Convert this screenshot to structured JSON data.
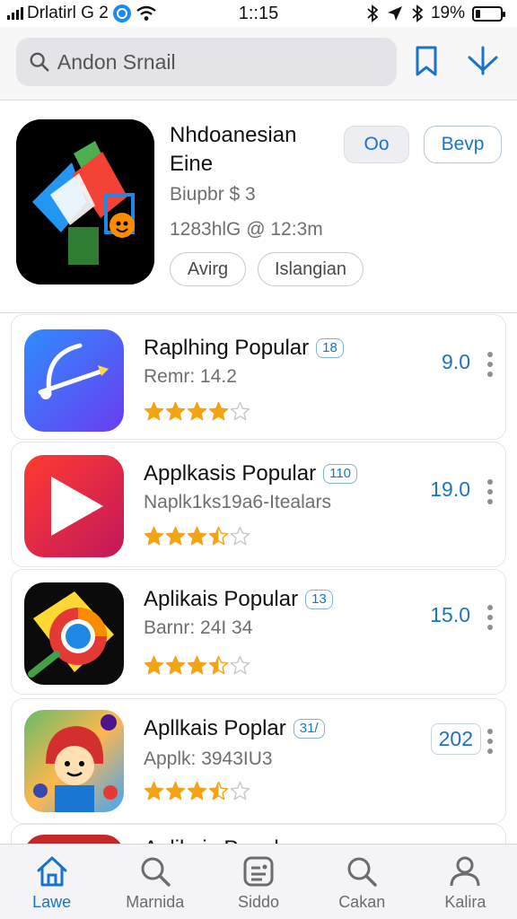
{
  "status_bar": {
    "carrier": "Drlatirl G 2",
    "time": "1::15",
    "battery": "19%",
    "battery_level": 0.19
  },
  "search": {
    "placeholder": "Andon Srnail"
  },
  "featured": {
    "title": "Nhdoanesian Eine",
    "button_o": "Oo",
    "button_b": "Bevp",
    "price": "Biupbr $ 3",
    "meta": "1283hlG @ 12:3m",
    "tags": [
      "Avirg",
      "Islangian"
    ]
  },
  "apps": [
    {
      "name": "Raplhing Popular",
      "badge": "18",
      "subtitle": "Remr: 14.2",
      "rating": "9.0",
      "stars": 4
    },
    {
      "name": "Applkasis Popular",
      "badge": "110",
      "subtitle": "Naplk1ks19a6-Itealars",
      "rating": "19.0",
      "stars": 3.5
    },
    {
      "name": "Aplikais Popular",
      "badge": "13",
      "subtitle": "Barnr: 24I 34",
      "rating": "15.0",
      "stars": 3.5
    },
    {
      "name": "Apllkais Poplar",
      "badge": "31/",
      "subtitle": "Applk: 3943IU3",
      "rating": "202",
      "stars": 3.5
    },
    {
      "name": "Aplikais Popular",
      "badge": "",
      "subtitle": "",
      "rating": "",
      "stars": 0
    }
  ],
  "tabs": [
    {
      "label": "Lawe",
      "icon": "home-icon",
      "active": true
    },
    {
      "label": "Marnida",
      "icon": "search-icon",
      "active": false
    },
    {
      "label": "Siddo",
      "icon": "apps-icon",
      "active": false
    },
    {
      "label": "Cakan",
      "icon": "search-icon",
      "active": false
    },
    {
      "label": "Kalira",
      "icon": "profile-icon",
      "active": false
    }
  ],
  "colors": {
    "accent": "#1a73c9",
    "star": "#f4a316",
    "star_empty": "#c7c7cc"
  }
}
